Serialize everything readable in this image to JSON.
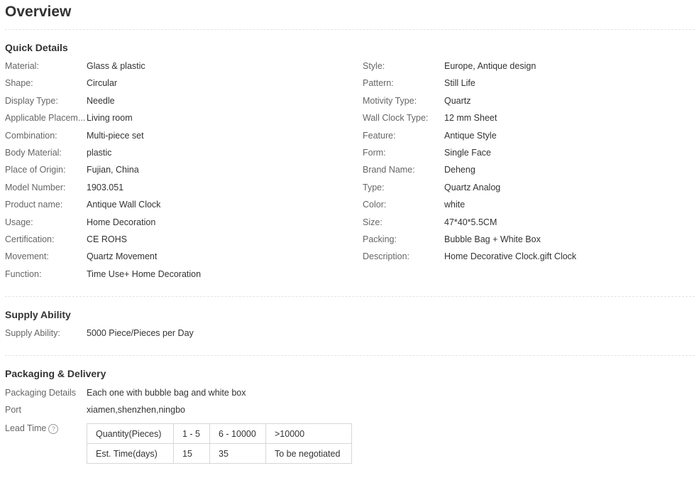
{
  "page": {
    "title": "Overview"
  },
  "quick_details": {
    "title": "Quick Details",
    "left": [
      {
        "label": "Material:",
        "value": "Glass & plastic"
      },
      {
        "label": "Shape:",
        "value": "Circular"
      },
      {
        "label": "Display Type:",
        "value": "Needle"
      },
      {
        "label": "Applicable Placem...",
        "value": "Living room"
      },
      {
        "label": "Combination:",
        "value": "Multi-piece set"
      },
      {
        "label": "Body Material:",
        "value": "plastic"
      },
      {
        "label": "Place of Origin:",
        "value": "Fujian, China"
      },
      {
        "label": "Model Number:",
        "value": "1903.051"
      },
      {
        "label": "Product name:",
        "value": "Antique Wall Clock"
      },
      {
        "label": "Usage:",
        "value": "Home Decoration"
      },
      {
        "label": "Certification:",
        "value": "CE ROHS"
      },
      {
        "label": "Movement:",
        "value": "Quartz Movement"
      },
      {
        "label": "Function:",
        "value": "Time Use+ Home Decoration"
      }
    ],
    "right": [
      {
        "label": "Style:",
        "value": "Europe, Antique design"
      },
      {
        "label": "Pattern:",
        "value": "Still Life"
      },
      {
        "label": "Motivity Type:",
        "value": "Quartz"
      },
      {
        "label": "Wall Clock Type:",
        "value": "12 mm Sheet"
      },
      {
        "label": "Feature:",
        "value": "Antique Style"
      },
      {
        "label": "Form:",
        "value": "Single Face"
      },
      {
        "label": "Brand Name:",
        "value": "Deheng"
      },
      {
        "label": "Type:",
        "value": "Quartz Analog"
      },
      {
        "label": "Color:",
        "value": "white"
      },
      {
        "label": "Size:",
        "value": "47*40*5.5CM"
      },
      {
        "label": "Packing:",
        "value": "Bubble Bag + White Box"
      },
      {
        "label": "Description:",
        "value": "Home Decorative Clock.gift Clock"
      }
    ]
  },
  "supply": {
    "title": "Supply Ability",
    "label": "Supply Ability:",
    "value": "5000 Piece/Pieces per Day"
  },
  "packaging": {
    "title": "Packaging & Delivery",
    "details_label": "Packaging Details",
    "details_value": "Each one with bubble bag and white box",
    "port_label": "Port",
    "port_value": "xiamen,shenzhen,ningbo",
    "lead_label": "Lead Time",
    "help_icon": "question-circle",
    "lead_table": {
      "rows": [
        [
          "Quantity(Pieces)",
          "1 - 5",
          "6 - 10000",
          ">10000"
        ],
        [
          "Est. Time(days)",
          "15",
          "35",
          "To be negotiated"
        ]
      ]
    }
  }
}
